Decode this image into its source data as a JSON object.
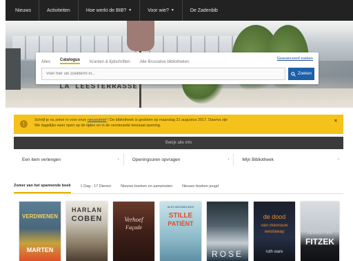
{
  "nav": {
    "items": [
      {
        "label": "Nieuws",
        "caret": false
      },
      {
        "label": "Activiteiten",
        "caret": false
      },
      {
        "label": "Hoe werkt de BIB?",
        "caret": true
      },
      {
        "label": "Voor wie?",
        "caret": true
      },
      {
        "label": "De Zadenbib",
        "caret": false
      }
    ]
  },
  "hero": {
    "sign_text": "LA LEESTERRASSE"
  },
  "search": {
    "tabs": [
      "Alles",
      "Catalogus",
      "Kranten & tijdschriften",
      "Alle Brusselse bibliotheken"
    ],
    "active_tab": "Catalogus",
    "advanced_link": "Geavanceerd zoeken",
    "placeholder": "Voer hier uw zoekterm in...",
    "button_label": "Zoeken"
  },
  "notice": {
    "line1_before": "Schrijf je nu zeker in voor onze",
    "link": "nieuwsbrief",
    "line1_after": "! De bibliotheek is gesloten op maandag 21 augustus 2017. Daarna zijn",
    "line2": "We dagelijks weer open op de tijden en in de vernieuwde leeszaal opening.",
    "close": "×"
  },
  "stay_button": "Bekijk alle info",
  "quick_links": [
    {
      "label": "Een item verlengen"
    },
    {
      "label": "Openingsuren opvragen"
    },
    {
      "label": "Mijn Bibliotheek"
    }
  ],
  "rail_tabs": {
    "items": [
      "Zomer van het spannende boek",
      "1 Dag - 17 Dienen",
      "Nieuwe boeken en aanwinsten",
      "Nieuwe boeken jeugd"
    ],
    "active": "Zomer van het spannende boek"
  },
  "books": [
    {
      "top": "VERDWENEN",
      "bottom": "MARTEN",
      "author": ""
    },
    {
      "top": "HARLAN",
      "bottom": "COBEN",
      "author": ""
    },
    {
      "top": "Verhoef",
      "bottom": "Façade",
      "author": ""
    },
    {
      "top": "STILLE",
      "bottom": "PATIËNT",
      "author": "ALEX MICHAELIDES"
    },
    {
      "top": "ROSE",
      "bottom": "",
      "author": ""
    },
    {
      "top": "de dood",
      "bottom": "van mevrouw westaway",
      "author": "ruth ware"
    },
    {
      "top": "SEBASTIAN",
      "bottom": "FITZEK",
      "author": ""
    }
  ]
}
